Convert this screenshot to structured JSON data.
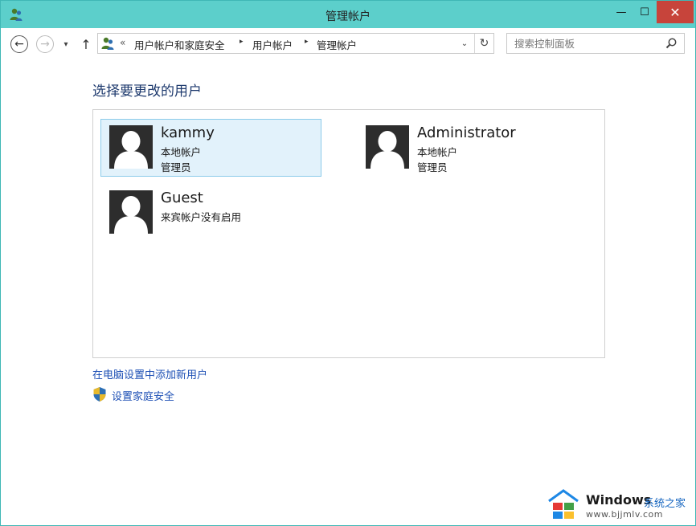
{
  "window": {
    "title": "管理帐户",
    "minimize_glyph": "—",
    "maximize_glyph": "☐",
    "close_glyph": "✕"
  },
  "nav": {
    "back_glyph": "←",
    "forward_glyph": "→",
    "recent_glyph": "▾",
    "up_glyph": "↑",
    "breadcrumb_prefix": "«",
    "breadcrumb": [
      "用户帐户和家庭安全",
      "用户帐户",
      "管理帐户"
    ],
    "separator_glyph": "▸",
    "dropdown_glyph": "⌄",
    "refresh_glyph": "↻",
    "search_placeholder": "搜索控制面板",
    "icons": [
      "user-accounts-icon",
      "search-icon"
    ]
  },
  "content": {
    "heading": "选择要更改的用户",
    "users": [
      {
        "name": "kammy",
        "line1": "本地帐户",
        "line2": "管理员",
        "selected": true
      },
      {
        "name": "Administrator",
        "line1": "本地帐户",
        "line2": "管理员",
        "selected": false
      },
      {
        "name": "Guest",
        "line1": "来宾帐户没有启用",
        "line2": "",
        "selected": false
      }
    ],
    "add_user_link": "在电脑设置中添加新用户",
    "family_safety_link": "设置家庭安全"
  },
  "colors": {
    "titlebar": "#5ccfcb",
    "close_button": "#c7443b",
    "heading": "#1e3a6e",
    "link": "#1e50b5",
    "selected_bg": "#e2f2fb",
    "selected_border": "#8ccbea"
  },
  "watermark": {
    "title": "Windows",
    "subtitle": "系统之家",
    "url": "www.bjjmlv.com"
  }
}
